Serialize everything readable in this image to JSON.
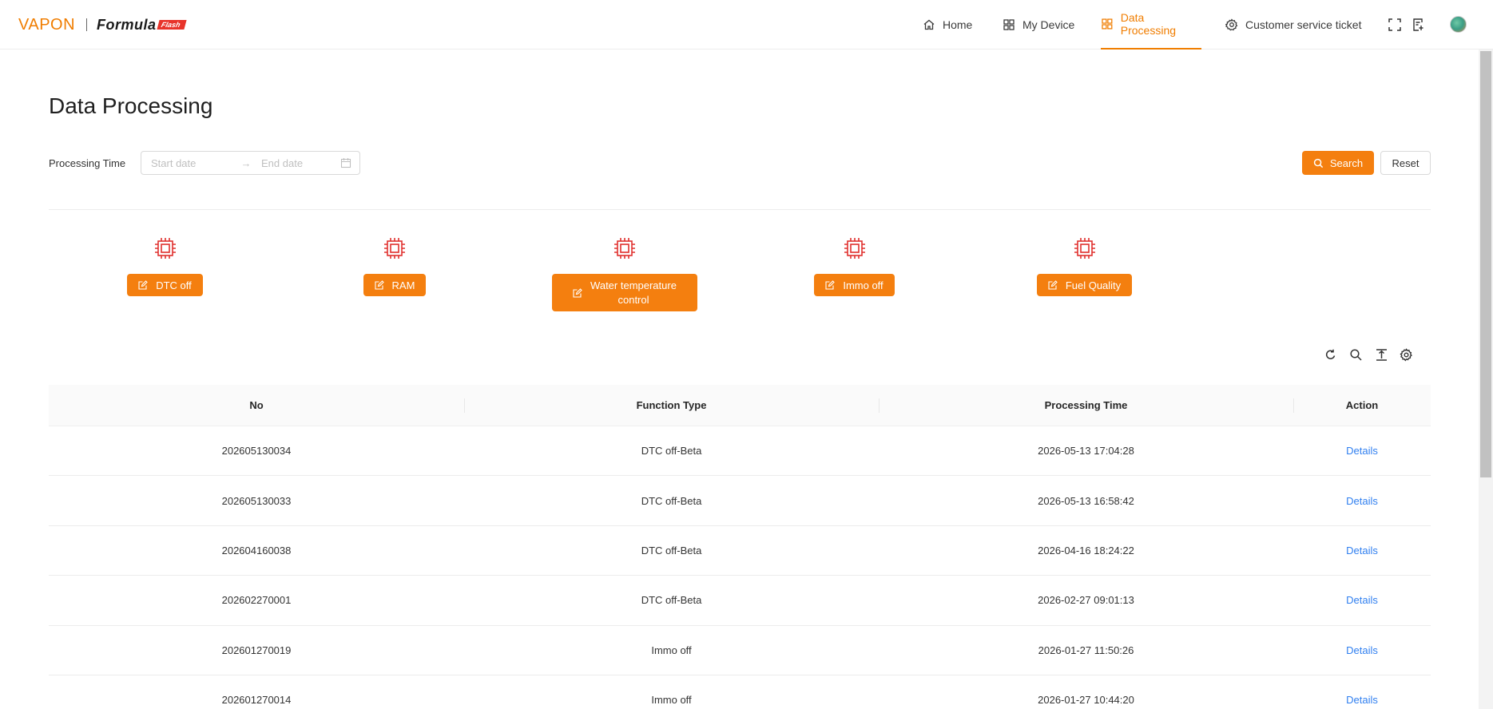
{
  "header": {
    "logo": {
      "vapon": "VAPON",
      "formula": "Formula",
      "flash": "Flash"
    },
    "nav": [
      {
        "label": "Home",
        "icon": "home-icon"
      },
      {
        "label": "My Device",
        "icon": "grid-icon"
      },
      {
        "label": "Data Processing",
        "icon": "grid-icon",
        "active": true
      },
      {
        "label": "Customer service ticket",
        "icon": "gear-icon"
      }
    ],
    "tools": [
      "fullscreen-icon",
      "export-icon",
      "avatar"
    ]
  },
  "page": {
    "title": "Data Processing",
    "filter": {
      "label": "Processing Time",
      "start_placeholder": "Start date",
      "end_placeholder": "End date"
    },
    "search_label": "Search",
    "reset_label": "Reset"
  },
  "functions": [
    {
      "label": "DTC off",
      "icon": "chip-icon"
    },
    {
      "label": "RAM",
      "icon": "chip-icon"
    },
    {
      "label_line1": "Water temperature",
      "label_line2": "control",
      "icon": "chip-icon"
    },
    {
      "label": "Immo off",
      "icon": "chip-icon"
    },
    {
      "label": "Fuel Quality",
      "icon": "chip-icon"
    }
  ],
  "table": {
    "toolbar": [
      "reload-icon",
      "search-icon",
      "column-height-icon",
      "setting-icon"
    ],
    "columns": [
      "No",
      "Function Type",
      "Processing Time",
      "Action"
    ],
    "rows": [
      {
        "no": "202605130034",
        "type": "DTC off-Beta",
        "time": "2026-05-13 17:04:28",
        "action": "Details"
      },
      {
        "no": "202605130033",
        "type": "DTC off-Beta",
        "time": "2026-05-13 16:58:42",
        "action": "Details"
      },
      {
        "no": "202604160038",
        "type": "DTC off-Beta",
        "time": "2026-04-16 18:24:22",
        "action": "Details"
      },
      {
        "no": "202602270001",
        "type": "DTC off-Beta",
        "time": "2026-02-27 09:01:13",
        "action": "Details"
      },
      {
        "no": "202601270019",
        "type": "Immo off",
        "time": "2026-01-27 11:50:26",
        "action": "Details"
      },
      {
        "no": "202601270014",
        "type": "Immo off",
        "time": "2026-01-27 10:44:20",
        "action": "Details"
      }
    ]
  },
  "colors": {
    "accent": "#f47f0f",
    "link": "#2f7ff0",
    "chip": "#e0312f"
  }
}
